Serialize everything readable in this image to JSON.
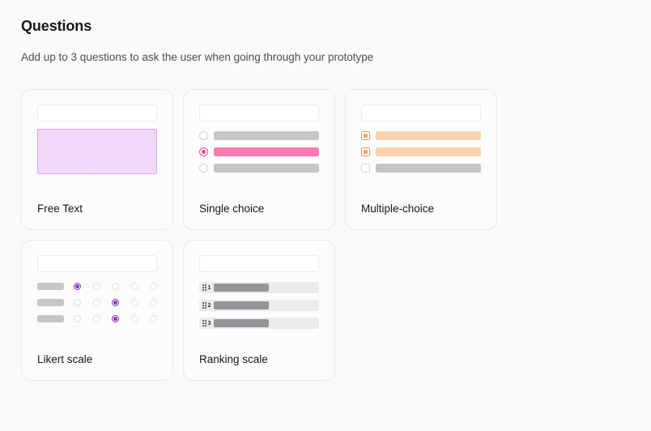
{
  "header": {
    "title": "Questions",
    "subtitle": "Add up to 3 questions to ask the user when going through your prototype"
  },
  "colors": {
    "page_background": "#FAFAFA",
    "card_background": "#FCFCFD",
    "card_border": "#EAEAEC",
    "title_text": "#17171A",
    "subtitle_text": "#4E4E55",
    "free_text_fill": "#F1D7F9",
    "free_text_border": "#C77DDC",
    "single_choice_accent": "#E8488B",
    "single_choice_bar": "#FB7BAE",
    "multiple_choice_accent": "#F0A75C",
    "multiple_choice_bar": "#FAD2AB",
    "likert_accent": "#8F3FC0",
    "neutral_bar": "#C6C6C9",
    "ranking_track": "#EBEBEC",
    "ranking_bar": "#949499"
  },
  "cards": [
    {
      "id": "free-text",
      "label": "Free Text",
      "preview_type": "free-text"
    },
    {
      "id": "single-choice",
      "label": "Single choice",
      "preview_type": "single-choice",
      "options": [
        {
          "selected": false
        },
        {
          "selected": true
        },
        {
          "selected": false
        }
      ]
    },
    {
      "id": "multiple-choice",
      "label": "Multiple-choice",
      "preview_type": "multiple-choice",
      "options": [
        {
          "selected": true
        },
        {
          "selected": true
        },
        {
          "selected": false
        }
      ]
    },
    {
      "id": "likert-scale",
      "label": "Likert scale",
      "preview_type": "likert",
      "scale_points": 5,
      "rows": [
        {
          "selected_index": 0
        },
        {
          "selected_index": 2
        },
        {
          "selected_index": 2
        }
      ]
    },
    {
      "id": "ranking-scale",
      "label": "Ranking scale",
      "preview_type": "ranking",
      "rows": [
        {
          "rank": "1"
        },
        {
          "rank": "2"
        },
        {
          "rank": "3"
        }
      ]
    }
  ]
}
